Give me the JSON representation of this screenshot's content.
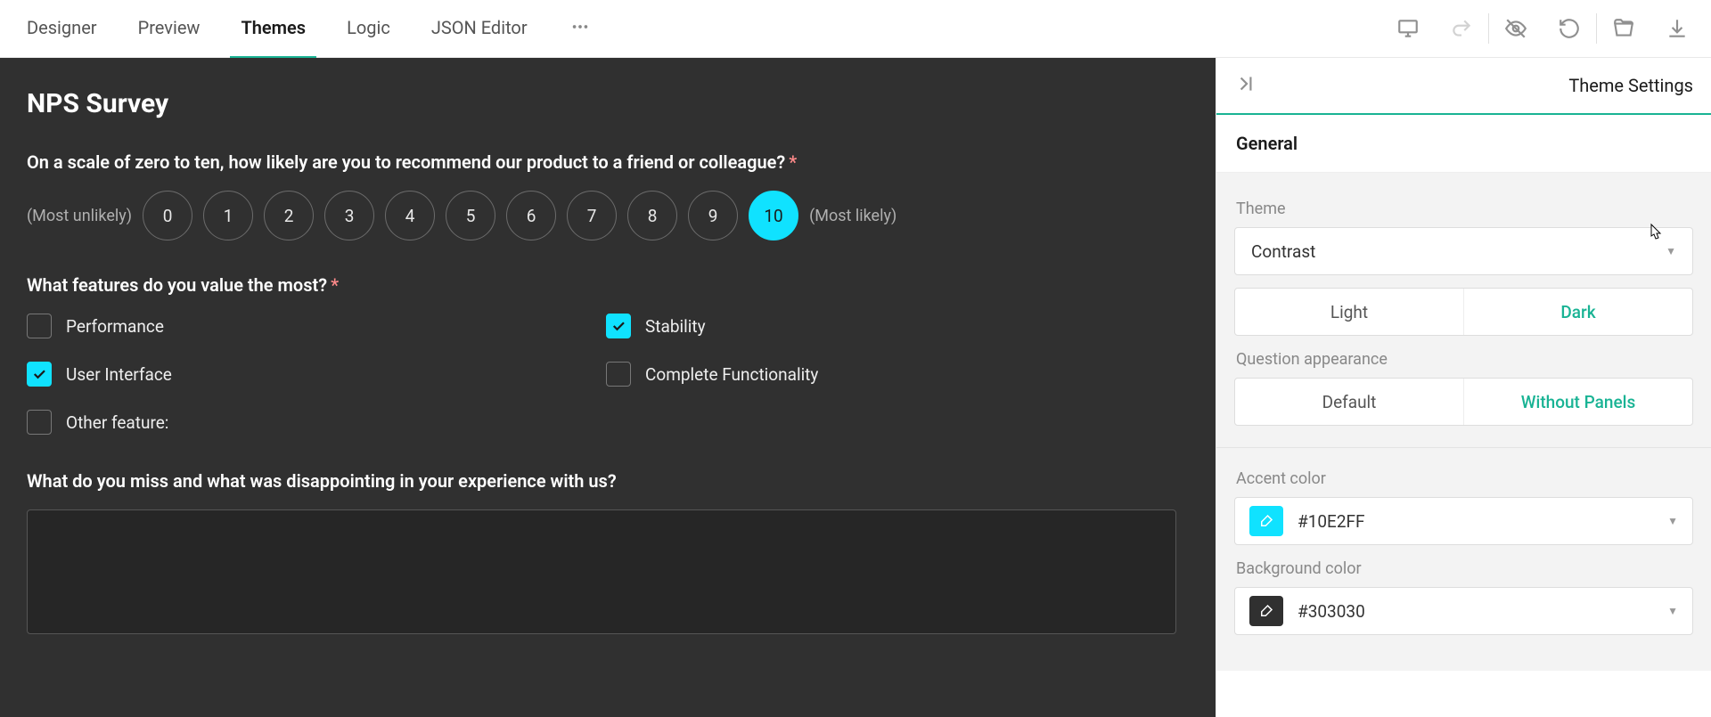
{
  "tabs": [
    "Designer",
    "Preview",
    "Themes",
    "Logic",
    "JSON Editor"
  ],
  "active_tab": 2,
  "settings_title": "Theme Settings",
  "sections": {
    "general": "General"
  },
  "theme": {
    "label": "Theme",
    "value": "Contrast",
    "mode_options": [
      "Light",
      "Dark"
    ],
    "mode_selected": 1,
    "appearance_label": "Question appearance",
    "appearance_options": [
      "Default",
      "Without Panels"
    ],
    "appearance_selected": 1
  },
  "colors": {
    "accent_label": "Accent color",
    "accent_value": "#10E2FF",
    "background_label": "Background color",
    "background_value": "#303030"
  },
  "survey": {
    "title": "NPS Survey",
    "q1": {
      "text": "On a scale of zero to ten, how likely are you to recommend our product to a friend or colleague?",
      "min_label": "(Most unlikely)",
      "max_label": "(Most likely)",
      "values": [
        "0",
        "1",
        "2",
        "3",
        "4",
        "5",
        "6",
        "7",
        "8",
        "9",
        "10"
      ],
      "selected": 10
    },
    "q2": {
      "text": "What features do you value the most?",
      "options": [
        {
          "label": "Performance",
          "checked": false
        },
        {
          "label": "Stability",
          "checked": true
        },
        {
          "label": "User Interface",
          "checked": true
        },
        {
          "label": "Complete Functionality",
          "checked": false
        },
        {
          "label": "Other feature:",
          "checked": false
        }
      ]
    },
    "q3": {
      "text": "What do you miss and what was disappointing in your experience with us?"
    }
  }
}
